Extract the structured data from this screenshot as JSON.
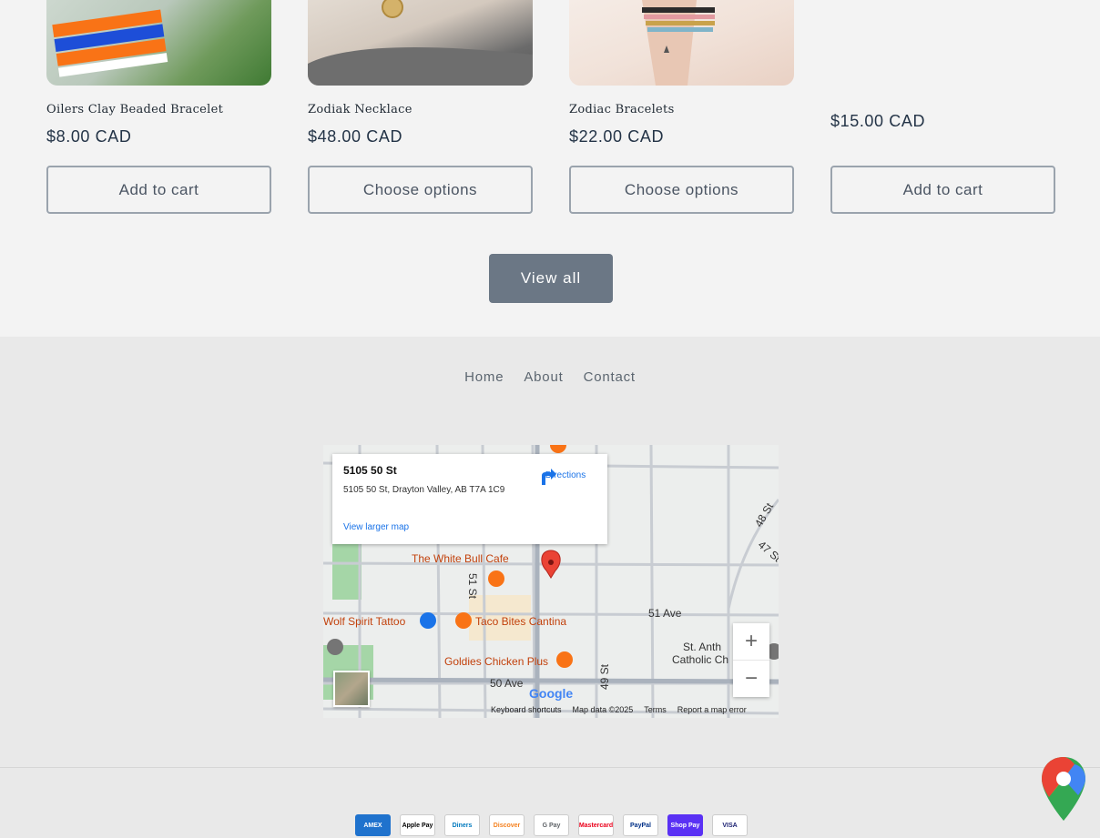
{
  "products": [
    {
      "title": "Oilers Clay Beaded Bracelet",
      "price": "$8.00 CAD",
      "button": "Add to cart",
      "has_image": true
    },
    {
      "title": "Zodiak Necklace",
      "price": "$48.00 CAD",
      "button": "Choose options",
      "has_image": true
    },
    {
      "title": "Zodiac Bracelets",
      "price": "$22.00 CAD",
      "button": "Choose options",
      "has_image": true
    },
    {
      "title": "",
      "price": "$15.00 CAD",
      "button": "Add to cart",
      "has_image": false
    }
  ],
  "view_all": "View all",
  "footer_nav": [
    "Home",
    "About",
    "Contact"
  ],
  "map": {
    "card_title": "5105 50 St",
    "card_address": "5105 50 St, Drayton Valley, AB T7A 1C9",
    "larger_link": "View larger map",
    "directions": "Directions",
    "labels": {
      "white_bull": "The White Bull Cafe",
      "wolf": "Wolf Spirit Tattoo",
      "taco": "Taco Bites Cantina",
      "goldies": "Goldies Chicken Plus",
      "ave51": "51 Ave",
      "ave50": "50 Ave",
      "st51": "51 St",
      "st49": "49 St",
      "st48": "48 St",
      "st47": "47 St",
      "st_anth": "St. Anth",
      "catholic": "Catholic Ch"
    },
    "zoom_in": "+",
    "zoom_out": "−",
    "google": "Google",
    "bottom": [
      "Keyboard shortcuts",
      "Map data ©2025",
      "Terms",
      "Report a map error"
    ]
  },
  "payments": [
    "AMEX",
    "Apple Pay",
    "Diners",
    "Discover",
    "G Pay",
    "Mastercard",
    "PayPal",
    "Shop Pay",
    "VISA"
  ]
}
